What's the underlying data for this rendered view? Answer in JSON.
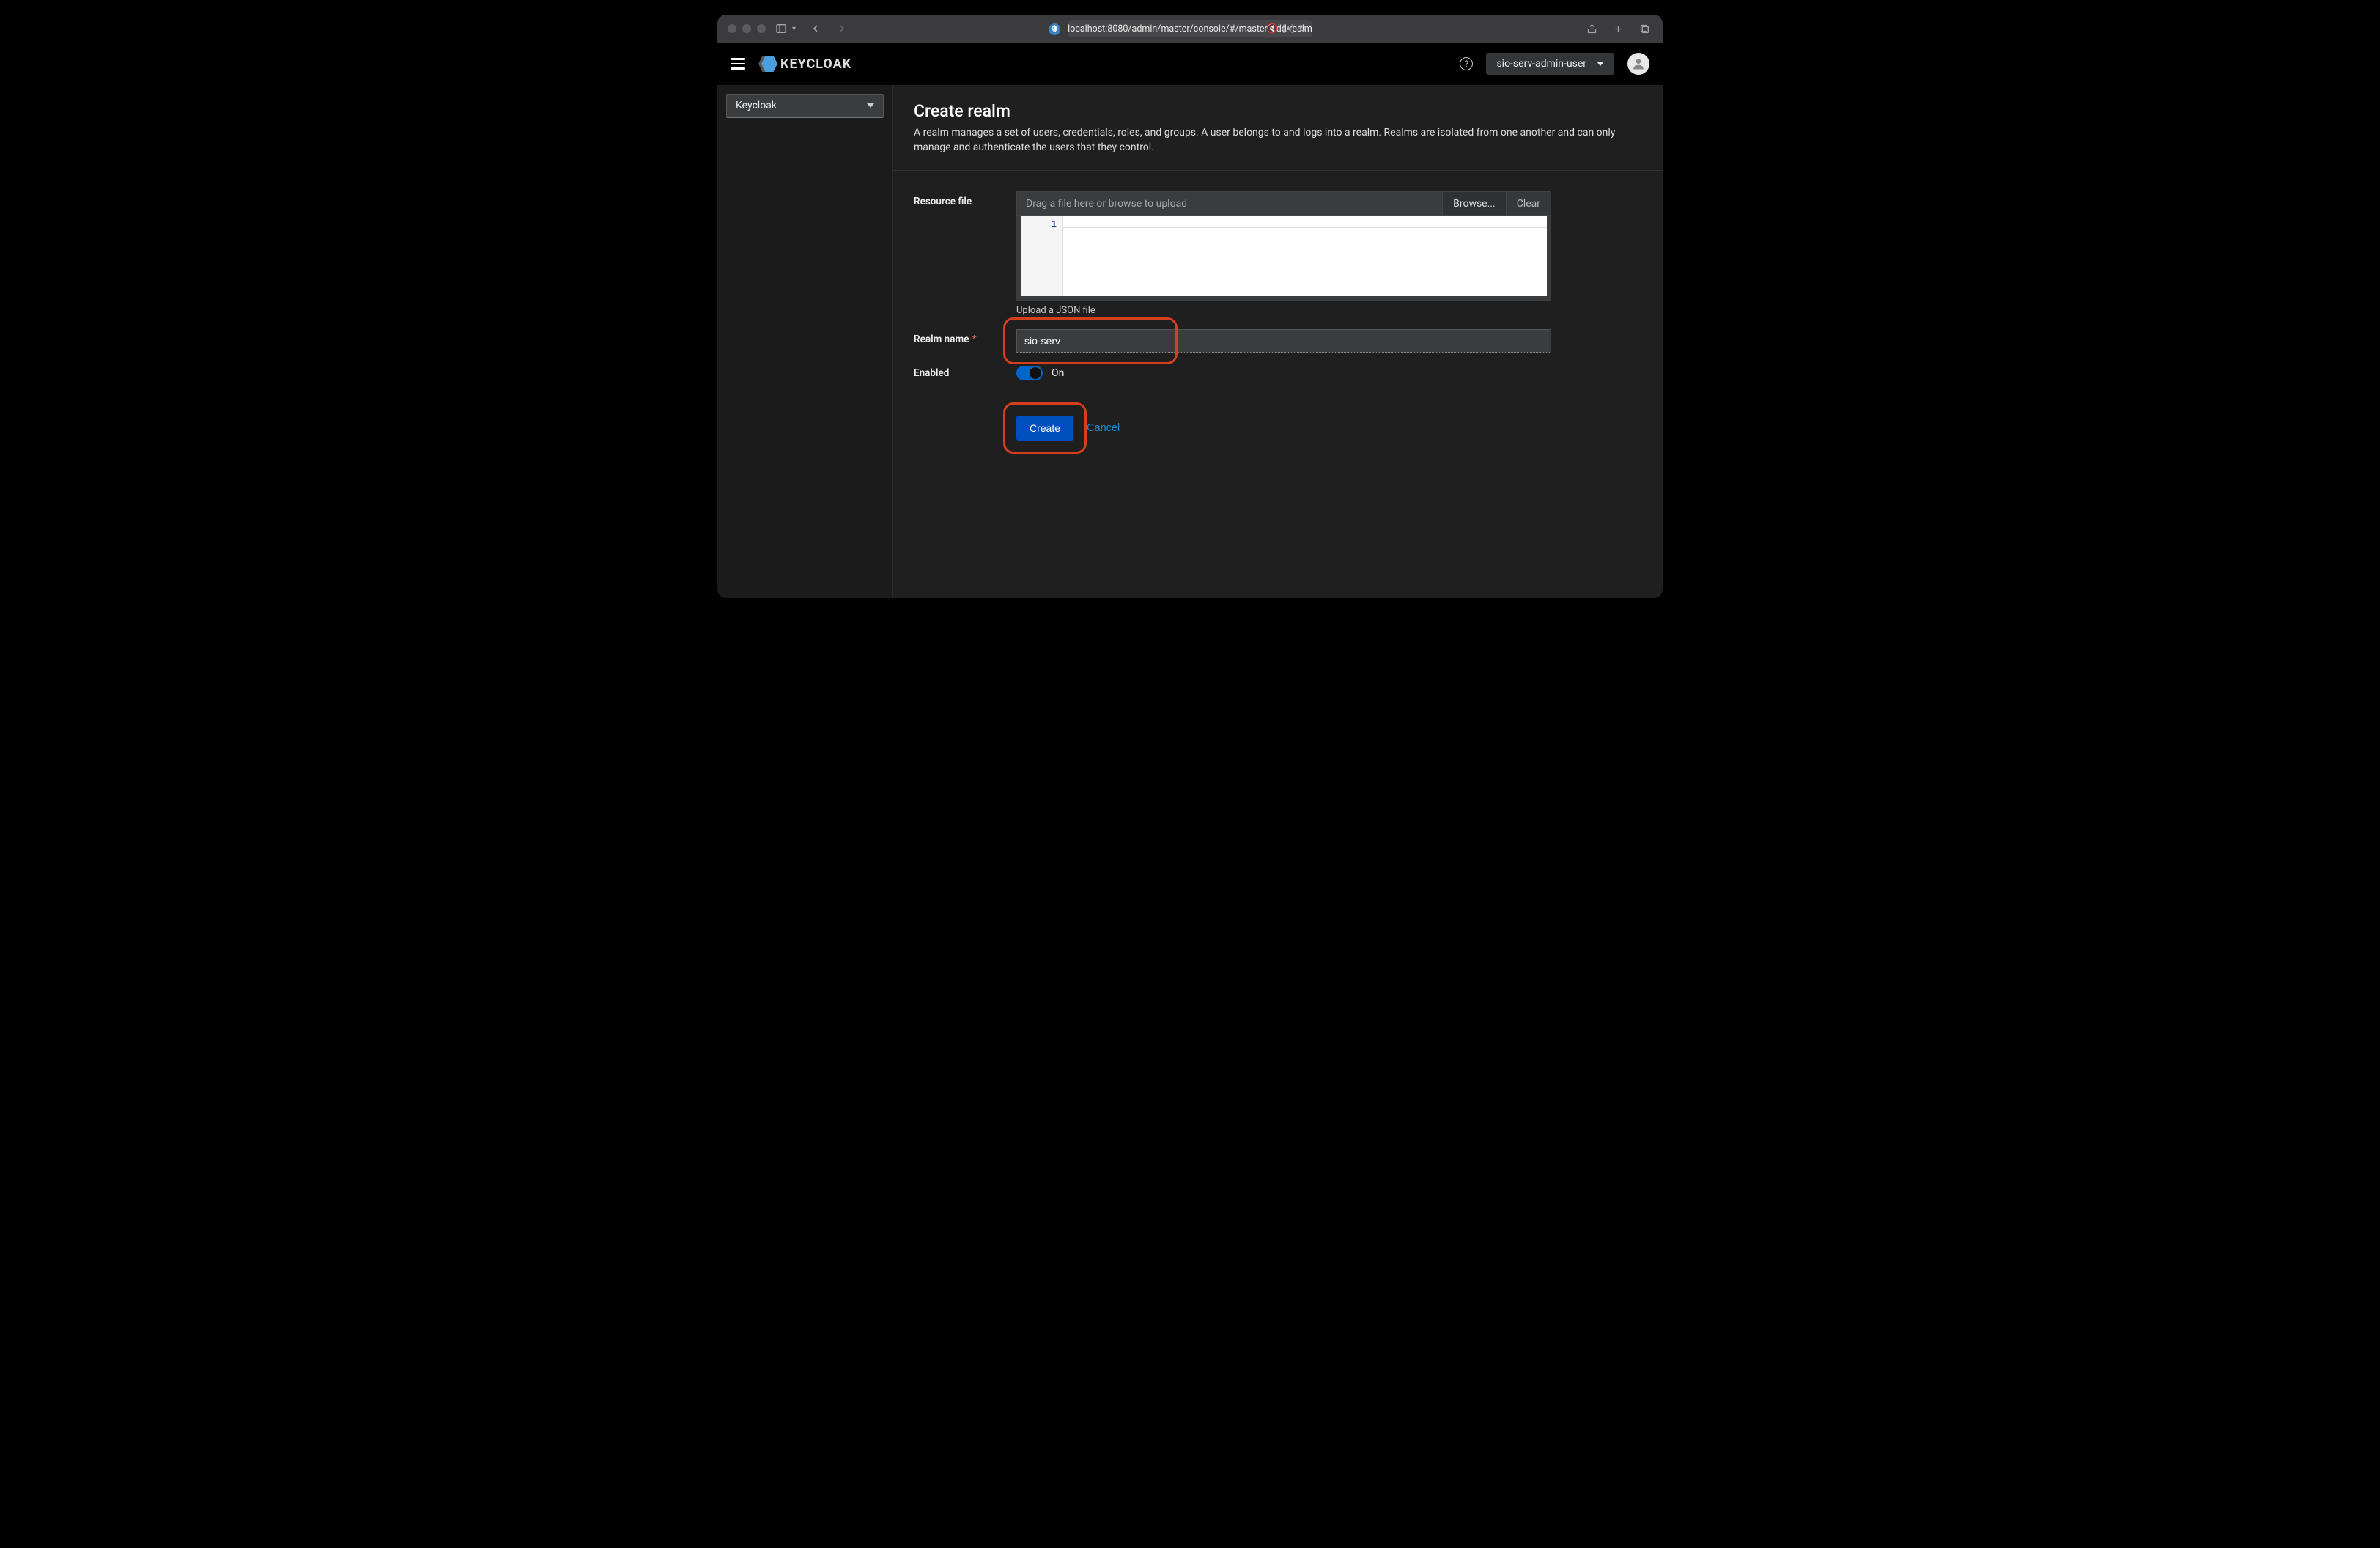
{
  "browser": {
    "url": "localhost:8080/admin/master/console/#/master/add-realm"
  },
  "header": {
    "brand": "KEYCLOAK",
    "user": "sio-serv-admin-user"
  },
  "sidebar": {
    "realm_selector": "Keycloak"
  },
  "page": {
    "title": "Create realm",
    "description": "A realm manages a set of users, credentials, roles, and groups. A user belongs to and logs into a realm. Realms are isolated from one another and can only manage and authenticate the users that they control."
  },
  "form": {
    "resource_file": {
      "label": "Resource file",
      "placeholder": "Drag a file here or browse to upload",
      "browse": "Browse...",
      "clear": "Clear",
      "line_number": "1",
      "helper": "Upload a JSON file"
    },
    "realm_name": {
      "label": "Realm name",
      "value": "sio-serv"
    },
    "enabled": {
      "label": "Enabled",
      "state": "On"
    },
    "actions": {
      "create": "Create",
      "cancel": "Cancel"
    }
  }
}
